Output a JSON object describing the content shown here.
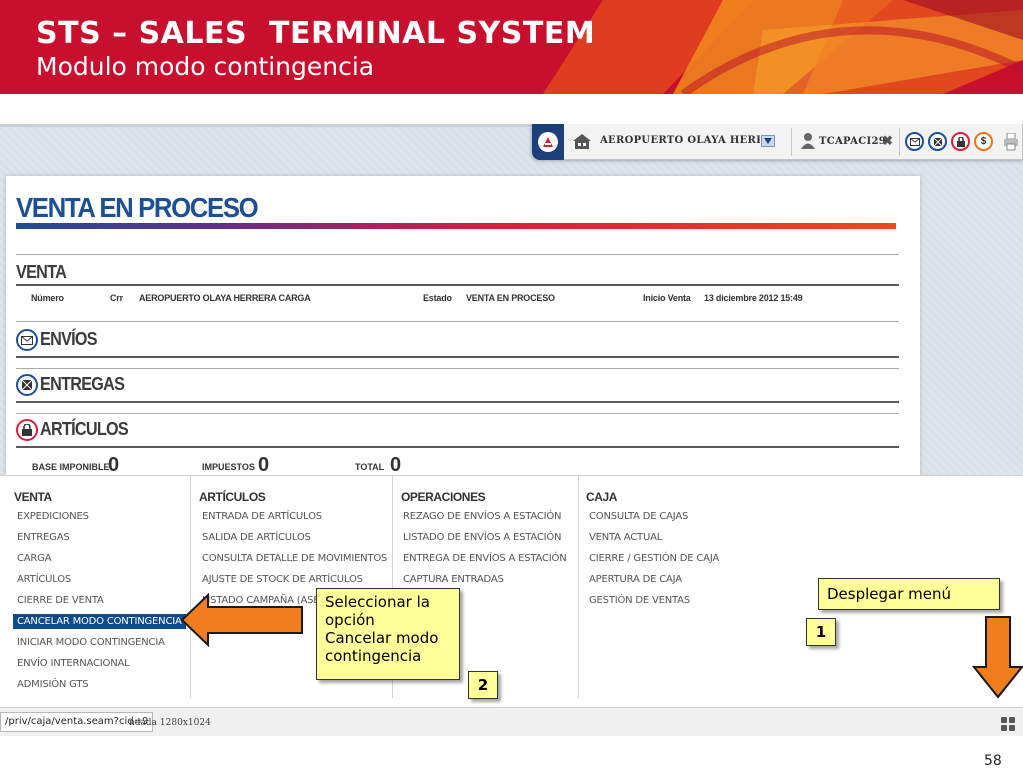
{
  "slide": {
    "title": "STS – SALES  TERMINAL SYSTEM",
    "subtitle": "Modulo modo contingencia",
    "page_number": "58"
  },
  "topbar": {
    "location": "AEROPUERTO OLAYA HERRERA",
    "user": "TCAPACI29",
    "close_glyph": "✖",
    "icons": [
      "app-logo-icon",
      "home-icon",
      "dropdown-arrow-icon",
      "user-icon",
      "close-icon",
      "envelope-icon",
      "package-icon",
      "lock-icon",
      "dollar-icon",
      "printer-icon"
    ],
    "dollar_glyph": "$"
  },
  "panel": {
    "title": "VENTA EN PROCESO",
    "venta_head": "VENTA",
    "venta_fields": {
      "numero_label": "Número",
      "crr_label": "Crr",
      "crr_value": "AEROPUERTO OLAYA HERRERA CARGA",
      "estado_label": "Estado",
      "estado_value": "VENTA EN PROCESO",
      "inicio_label": "Inicio Venta",
      "inicio_value": "13 diciembre 2012 15:49"
    },
    "envios_head": "ENVÍOS",
    "entregas_head": "ENTREGAS",
    "articulos_head": "ARTÍCULOS",
    "totals": {
      "base_label": "BASE IMPONIBLE",
      "base_value": "0",
      "impuestos_label": "IMPUESTOS",
      "impuestos_value": "0",
      "total_label": "TOTAL",
      "total_value": "0"
    }
  },
  "menu": {
    "venta": {
      "head": "VENTA",
      "items": [
        "EXPEDICIONES",
        "ENTREGAS",
        "CARGA",
        "ARTÍCULOS",
        "CIERRE DE VENTA",
        "CANCELAR MODO CONTINGENCIA",
        "INICIAR MODO CONTINGENCIA",
        "ENVÍO INTERNACIONAL",
        "ADMISIÓN GTS"
      ]
    },
    "articulos": {
      "head": "ARTÍCULOS",
      "items": [
        "ENTRADA DE ARTÍCULOS",
        "SALIDA DE ARTÍCULOS",
        "CONSULTA DETALLE DE MOVIMIENTOS",
        "AJUSTE DE STOCK DE ARTÍCULOS",
        "LISTADO CAMPAÑA (ASES"
      ]
    },
    "operaciones": {
      "head": "OPERACIONES",
      "items": [
        "REZAGO DE ENVÍOS A ESTACIÓN",
        "LISTADO DE ENVÍOS A ESTACIÓN",
        "ENTREGA DE ENVÍOS A ESTACIÓN",
        "CAPTURA ENTRADAS"
      ]
    },
    "caja": {
      "head": "CAJA",
      "items": [
        "CONSULTA DE CAJAS",
        "VENTA ACTUAL",
        "CIERRE / GESTIÓN DE CAJA",
        "APERTURA DE CAJA",
        "GESTIÓN DE VENTAS"
      ]
    }
  },
  "statusbar": {
    "url": "/priv/caja/venta.seam?cid=9",
    "resolution_text": "ndada 1280x1024"
  },
  "callouts": {
    "seleccionar": [
      "Seleccionar la",
      "opción",
      "Cancelar modo",
      "contingencia"
    ],
    "desplegar": "Desplegar menú",
    "step1": "1",
    "step2": "2"
  },
  "colors": {
    "header_red": "#c8102e",
    "brand_blue": "#1d4f95",
    "menu_active": "#0e4a8c",
    "callout_yellow": "#ffff99",
    "arrow_orange": "#f07d1e"
  }
}
